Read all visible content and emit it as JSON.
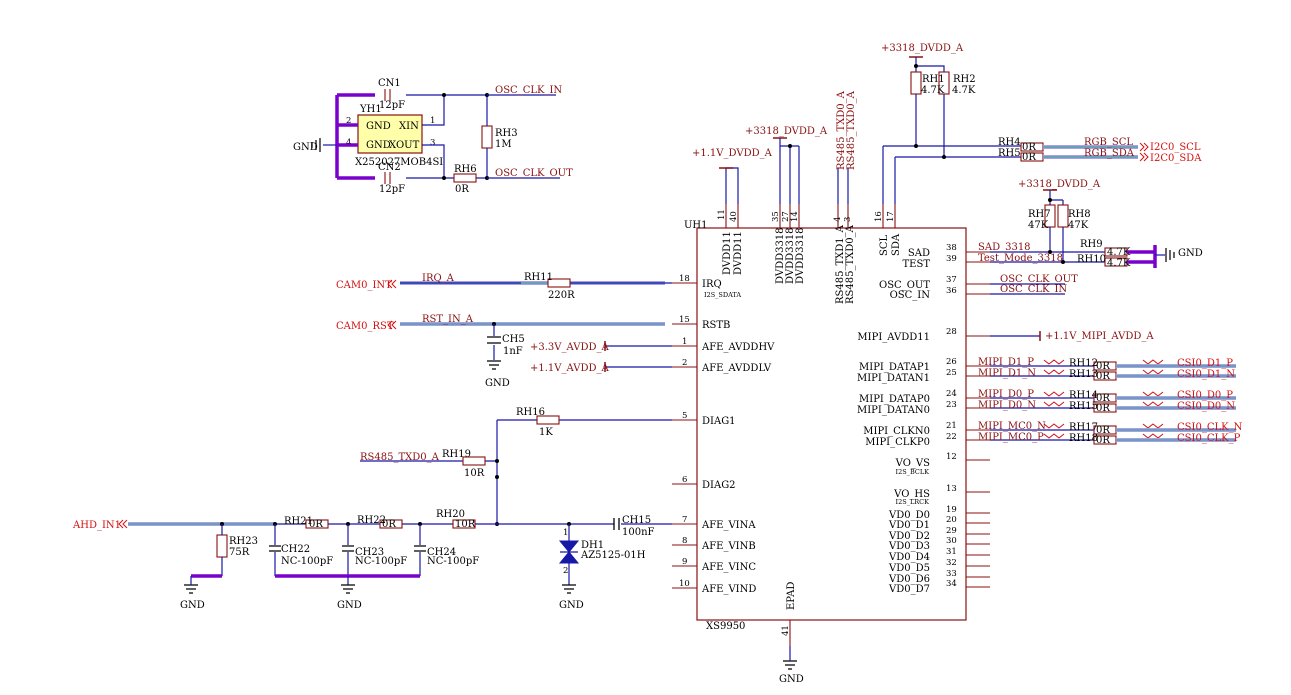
{
  "ic": {
    "designator": "UH1",
    "part": "XS9950",
    "left_pins": [
      {
        "num": "18",
        "name": "IRQ"
      },
      {
        "num": "15",
        "name": "RSTB"
      },
      {
        "num": "1",
        "name": "AFE_AVDDHV"
      },
      {
        "num": "2",
        "name": "AFE_AVDDLV"
      },
      {
        "num": "5",
        "name": "DIAG1"
      },
      {
        "num": "6",
        "name": "DIAG2"
      },
      {
        "num": "7",
        "name": "AFE_VINA"
      },
      {
        "num": "8",
        "name": "AFE_VINB"
      },
      {
        "num": "9",
        "name": "AFE_VINC"
      },
      {
        "num": "10",
        "name": "AFE_VIND"
      }
    ],
    "top_pins": [
      {
        "num": "11",
        "name": "DVDD11"
      },
      {
        "num": "40",
        "name": "DVDD11"
      },
      {
        "num": "35",
        "name": "DVDD3318"
      },
      {
        "num": "27",
        "name": "DVDD3318"
      },
      {
        "num": "14",
        "name": "DVDD3318"
      },
      {
        "num": "4",
        "name": "RS485_TXD1_A"
      },
      {
        "num": "3",
        "name": "RS485_TXD0_A"
      },
      {
        "num": "16",
        "name": "SCL"
      },
      {
        "num": "17",
        "name": "SDA"
      }
    ],
    "right_pins": [
      {
        "num": "38",
        "name": "SAD"
      },
      {
        "num": "39",
        "name": "TEST"
      },
      {
        "num": "37",
        "name": "OSC_OUT"
      },
      {
        "num": "36",
        "name": "OSC_IN"
      },
      {
        "num": "28",
        "name": "MIPI_AVDD11"
      },
      {
        "num": "26",
        "name": "MIPI_DATAP1"
      },
      {
        "num": "25",
        "name": "MIPI_DATAN1"
      },
      {
        "num": "24",
        "name": "MIPI_DATAP0"
      },
      {
        "num": "23",
        "name": "MIPI_DATAN0"
      },
      {
        "num": "21",
        "name": "MIPI_CLKN0"
      },
      {
        "num": "22",
        "name": "MIPI_CLKP0"
      },
      {
        "num": "12",
        "name": "VO_VS"
      },
      {
        "num": "13",
        "name": "VO_HS"
      },
      {
        "num": "19",
        "name": "VD0_D0"
      },
      {
        "num": "20",
        "name": "VD0_D1"
      },
      {
        "num": "29",
        "name": "VD0_D2"
      },
      {
        "num": "30",
        "name": "VD0_D3"
      },
      {
        "num": "31",
        "name": "VD0_D4"
      },
      {
        "num": "32",
        "name": "VD0_D5"
      },
      {
        "num": "33",
        "name": "VD0_D6"
      },
      {
        "num": "34",
        "name": "VD0_D7"
      }
    ],
    "bottom_pin": {
      "num": "41",
      "name": "EPAD"
    },
    "alt_labels": {
      "irq": "I2S_SDATA",
      "vs": "I2S_BCLK",
      "hs": "I2S_LRCK"
    }
  },
  "crystal": {
    "designator": "YH1",
    "part": "X252027MOB4SI",
    "pins": {
      "p1": "1",
      "p2": "2",
      "p3": "3",
      "p4": "4"
    },
    "gnd1": "GND",
    "xin": "XIN",
    "gnd2": "GND",
    "xout": "XOUT"
  },
  "components": {
    "cn1": {
      "des": "CN1",
      "val": "12pF"
    },
    "cn2": {
      "des": "CN2",
      "val": "12pF"
    },
    "rh3": {
      "des": "RH3",
      "val": "1M"
    },
    "rh6": {
      "des": "RH6",
      "val": "0R"
    },
    "rh11": {
      "des": "RH11",
      "val": "220R"
    },
    "ch5": {
      "des": "CH5",
      "val": "1nF"
    },
    "rh16": {
      "des": "RH16",
      "val": "1K"
    },
    "rh19": {
      "des": "RH19",
      "val": "10R"
    },
    "rh21": {
      "des": "RH21",
      "val": "0R"
    },
    "rh22": {
      "des": "RH22",
      "val": "0R"
    },
    "rh20": {
      "des": "RH20",
      "val": "10R"
    },
    "rh23": {
      "des": "RH23",
      "val": "75R"
    },
    "ch22": {
      "des": "CH22",
      "val": "NC-100pF"
    },
    "ch23": {
      "des": "CH23",
      "val": "NC-100pF"
    },
    "ch24": {
      "des": "CH24",
      "val": "NC-100pF"
    },
    "ch15": {
      "des": "CH15",
      "val": "100nF"
    },
    "dh1": {
      "des": "DH1",
      "val": "AZ5125-01H",
      "p1": "1",
      "p2": "2"
    },
    "rh1": {
      "des": "RH1",
      "val": "4.7K"
    },
    "rh2": {
      "des": "RH2",
      "val": "4.7K"
    },
    "rh4": {
      "des": "RH4",
      "val": "0R"
    },
    "rh5": {
      "des": "RH5",
      "val": "0R"
    },
    "rh7": {
      "des": "RH7",
      "val": "47K"
    },
    "rh8": {
      "des": "RH8",
      "val": "47K"
    },
    "rh9": {
      "des": "RH9",
      "val": "4.7K"
    },
    "rh10": {
      "des": "RH10",
      "val": "4.7K"
    },
    "rh12": {
      "des": "RH12",
      "val": "0R"
    },
    "rh13": {
      "des": "RH13",
      "val": "0R"
    },
    "rh14": {
      "des": "RH14",
      "val": "0R"
    },
    "rh15": {
      "des": "RH15",
      "val": "0R"
    },
    "rh17": {
      "des": "RH17",
      "val": "0R"
    },
    "rh18": {
      "des": "RH18",
      "val": "0R"
    }
  },
  "nets": {
    "osc_clk_in": "OSC_CLK_IN",
    "osc_clk_out": "OSC_CLK_OUT",
    "irq_a": "IRQ_A",
    "rst_in_a": "RST_IN_A",
    "avdd33": "+3.3V_AVDD_A",
    "avdd11": "+1.1V_AVDD_A",
    "rs485_txd0": "RS485_TXD0_A",
    "dvdd11": "+1.1V_DVDD_A",
    "dvdd3318_top": "+3318_DVDD_A",
    "dvdd3318_pullup": "+3318_DVDD_A",
    "dvdd3318_sad": "+3318_DVDD_A",
    "rgb_scl": "RGB_SCL",
    "rgb_sda": "RGB_SDA",
    "sad_3318": "SAD_3318",
    "test_mode": "Test_Mode_3318",
    "osc_clk_out_r": "OSC_CLK_OUT",
    "osc_clk_in_r": "OSC_CLK_IN",
    "mipi_avdd": "+1.1V_MIPI_AVDD_A",
    "mipi_d1p": "MIPI_D1_P",
    "mipi_d1n": "MIPI_D1_N",
    "mipi_d0p": "MIPI_D0_P",
    "mipi_d0n": "MIPI_D0_N",
    "mipi_mc0n": "MIPI_MC0_N",
    "mipi_mc0p": "MIPI_MC0_P",
    "gnd": "GND"
  },
  "ports": {
    "cam0_int": "CAM0_INT",
    "cam0_rst": "CAM0_RST",
    "ahd_in1": "AHD_IN1",
    "i2c0_scl": "I2C0_SCL",
    "i2c0_sda": "I2C0_SDA",
    "csi0_d1p": "CSI0_D1_P",
    "csi0_d1n": "CSI0_D1_N",
    "csi0_d0p": "CSI0_D0_P",
    "csi0_d0n": "CSI0_D0_N",
    "csi0_clkn": "CSI0_CLK_N",
    "csi0_clkp": "CSI0_CLK_P"
  },
  "colors": {
    "wire": "#1818a8",
    "body": "#8a1010",
    "port": "#d41010",
    "bus": "#7a00cc"
  }
}
